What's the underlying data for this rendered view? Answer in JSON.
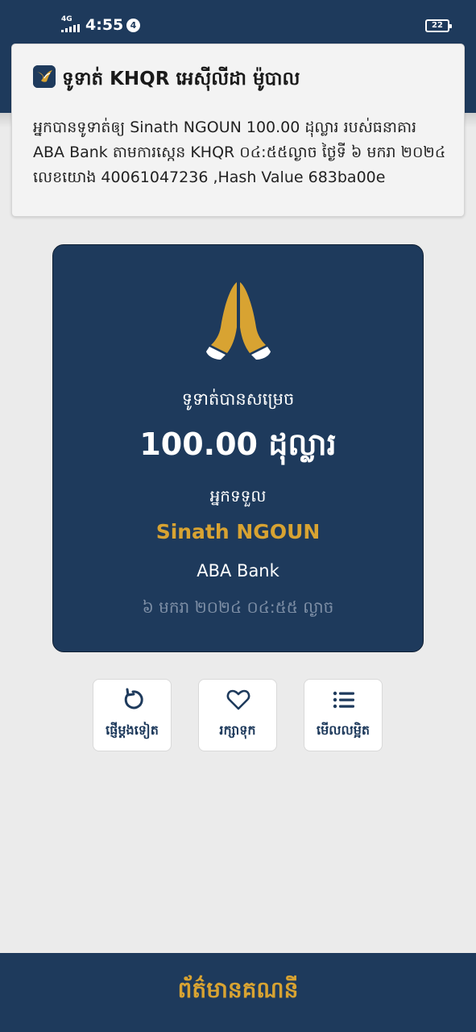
{
  "status_bar": {
    "network": "4G",
    "time": "4:55",
    "notification_count": "4",
    "battery": "22"
  },
  "notification": {
    "app_icon": "bird-logo-icon",
    "title": "ទូទាត់ KHQR អេស៊ីលីដា ម៉ូបាល",
    "body": "អ្នកបានទូទាត់ឲ្យ Sinath NGOUN 100.00 ដុល្លារ របស់ធនាគារ ABA Bank តាមការស្កេន KHQR ០៤:៥៥ល្ងាច ថ្ងៃទី ៦ មករា ២០២៤ លេខយោង 40061047236 ,Hash Value 683ba00e"
  },
  "receipt": {
    "icon": "praying-hands-icon",
    "status_text": "ទូទាត់បានសម្រេច",
    "amount": "100.00 ដុល្លារ",
    "receiver_label": "អ្នកទទួល",
    "receiver_name": "Sinath NGOUN",
    "bank": "ABA Bank",
    "datetime": "៦ មករា ២០២៤ ០៤:៥៥ ល្ងាច"
  },
  "actions": [
    {
      "label": "ផ្ញើម្តងទៀត",
      "icon": "redo-icon"
    },
    {
      "label": "រក្សាទុក",
      "icon": "heart-icon"
    },
    {
      "label": "មើលលម្អិត",
      "icon": "list-icon"
    }
  ],
  "bottom_bar": {
    "label": "ព័ត៌មានគណនី"
  },
  "colors": {
    "primary": "#1e3a5c",
    "gold": "#d8a332",
    "background": "#ebebeb"
  }
}
